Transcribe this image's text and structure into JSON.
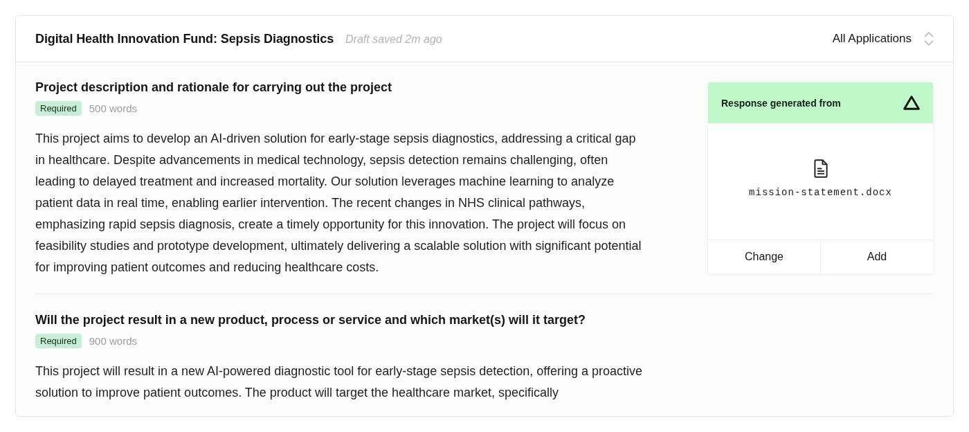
{
  "header": {
    "title": "Digital Health Innovation Fund: Sepsis Diagnostics",
    "status": "Draft saved 2m ago",
    "filter": {
      "label": "All Applications"
    }
  },
  "questions": [
    {
      "title": "Project description and rationale for carrying out the project",
      "badge": "Required",
      "word_limit": "500 words",
      "answer": "This project aims to develop an AI-driven solution for early-stage sepsis diagnostics, addressing a critical gap in healthcare. Despite advancements in medical technology, sepsis detection remains challenging, often leading to delayed treatment and increased mortality. Our solution leverages machine learning to analyze patient data in real time, enabling earlier intervention. The recent changes in NHS clinical pathways, emphasizing rapid sepsis diagnosis, create a timely opportunity for this innovation. The project will focus on feasibility studies and prototype development, ultimately delivering a scalable solution with significant potential for improving patient outcomes and reducing healthcare costs.",
      "source": {
        "heading": "Response generated from",
        "file": "mission-statement.docx",
        "buttons": [
          "Change",
          "Add"
        ]
      }
    },
    {
      "title": "Will the project result in a new product, process or service and which market(s) will it target?",
      "badge": "Required",
      "word_limit": "900 words",
      "answer": "This project will result in a new AI-powered diagnostic tool for early-stage sepsis detection, offering a proactive solution to improve patient outcomes. The product will target the healthcare market, specifically"
    }
  ]
}
